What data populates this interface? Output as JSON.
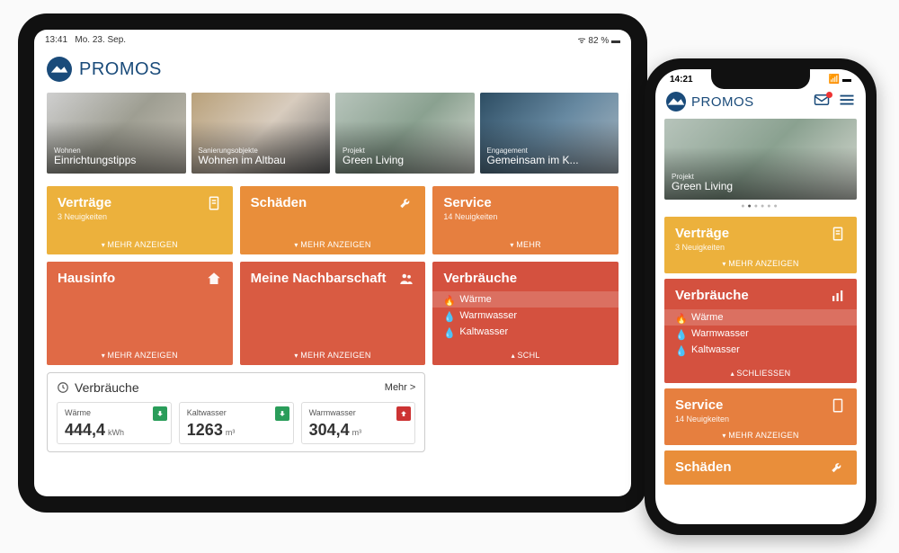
{
  "brand": "PROMOS",
  "tablet": {
    "status": {
      "time": "13:41",
      "date": "Mo. 23. Sep.",
      "battery": "82 %"
    },
    "carousel": [
      {
        "category": "Wohnen",
        "title": "Einrichtungstipps"
      },
      {
        "category": "Sanierungsobjekte",
        "title": "Wohnen im Altbau"
      },
      {
        "category": "Projekt",
        "title": "Green Living"
      },
      {
        "category": "Engagement",
        "title": "Gemeinsam im K..."
      }
    ],
    "tiles": {
      "vertraege": {
        "title": "Verträge",
        "sub": "3 Neuigkeiten",
        "more": "MEHR ANZEIGEN"
      },
      "schaeden": {
        "title": "Schäden",
        "more": "MEHR ANZEIGEN"
      },
      "service": {
        "title": "Service",
        "sub": "14 Neuigkeiten",
        "more": "MEHR"
      },
      "hausinfo": {
        "title": "Hausinfo",
        "more": "MEHR ANZEIGEN"
      },
      "nachbarschaft": {
        "title": "Meine Nachbarschaft",
        "more": "MEHR ANZEIGEN"
      },
      "verbraeuche": {
        "title": "Verbräuche",
        "items": [
          "Wärme",
          "Warmwasser",
          "Kaltwasser"
        ],
        "less": "SCHL"
      }
    },
    "widget": {
      "title": "Verbräuche",
      "more": "Mehr >",
      "cards": [
        {
          "label": "Wärme",
          "value": "444,4",
          "unit": "kWh",
          "trend": "down"
        },
        {
          "label": "Kaltwasser",
          "value": "1263",
          "unit": "m³",
          "trend": "down"
        },
        {
          "label": "Warmwasser",
          "value": "304,4",
          "unit": "m³",
          "trend": "up"
        }
      ]
    }
  },
  "phone": {
    "status_time": "14:21",
    "carousel": {
      "category": "Projekt",
      "title": "Green Living"
    },
    "tiles": {
      "vertraege": {
        "title": "Verträge",
        "sub": "3 Neuigkeiten",
        "more": "MEHR ANZEIGEN"
      },
      "verbraeuche": {
        "title": "Verbräuche",
        "items": [
          "Wärme",
          "Warmwasser",
          "Kaltwasser"
        ],
        "less": "SCHLIESSEN"
      },
      "service": {
        "title": "Service",
        "sub": "14 Neuigkeiten",
        "more": "MEHR ANZEIGEN"
      },
      "schaeden": {
        "title": "Schäden"
      }
    }
  }
}
